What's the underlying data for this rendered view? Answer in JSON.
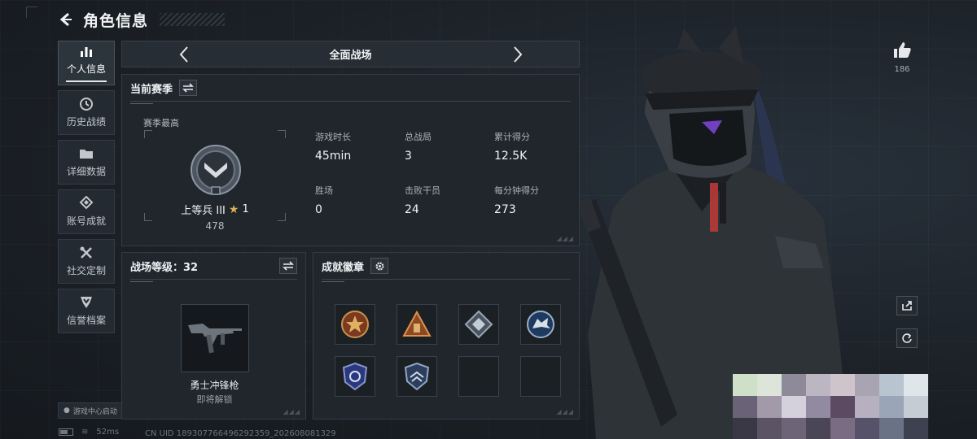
{
  "header": {
    "title": "角色信息"
  },
  "sidebar": {
    "items": [
      {
        "label": "个人信息",
        "icon": "bar-chart-icon",
        "active": true
      },
      {
        "label": "历史战绩",
        "icon": "clock-icon",
        "active": false
      },
      {
        "label": "详细数据",
        "icon": "folder-icon",
        "active": false
      },
      {
        "label": "账号成就",
        "icon": "achievement-icon",
        "active": false
      },
      {
        "label": "社交定制",
        "icon": "tools-icon",
        "active": false
      },
      {
        "label": "信誉档案",
        "icon": "shield-icon",
        "active": false
      }
    ],
    "launch_badge": "游戏中心启动"
  },
  "mode": {
    "label": "全面战场"
  },
  "season": {
    "title": "当前赛季",
    "best_label": "赛季最高",
    "rank_name": "上等兵 III",
    "rank_stars": "1",
    "rank_score": "478",
    "stats": [
      {
        "label": "游戏时长",
        "value": "45min"
      },
      {
        "label": "总战局",
        "value": "3"
      },
      {
        "label": "累计得分",
        "value": "12.5K"
      },
      {
        "label": "胜场",
        "value": "0"
      },
      {
        "label": "击败干员",
        "value": "24"
      },
      {
        "label": "每分钟得分",
        "value": "273"
      }
    ]
  },
  "level": {
    "title": "战场等级：32",
    "weapon_name": "勇士冲锋枪",
    "weapon_status": "即将解锁"
  },
  "achievements": {
    "title": "成就徽章",
    "badges": [
      {
        "icon": "star-medal-icon",
        "color": "#b5562a"
      },
      {
        "icon": "triangle-badge-icon",
        "color": "#c8743a"
      },
      {
        "icon": "diamond-badge-icon",
        "color": "#7a8796"
      },
      {
        "icon": "wolf-badge-icon",
        "color": "#3c6aa0"
      },
      {
        "icon": "police-badge-icon",
        "color": "#4a5ec0"
      },
      {
        "icon": "shield-crest-icon",
        "color": "#5c7aa8"
      },
      {
        "icon": "empty-slot",
        "color": ""
      },
      {
        "icon": "empty-slot",
        "color": ""
      }
    ]
  },
  "right": {
    "like_count": "186"
  },
  "status": {
    "ping": "52ms",
    "uid": "CN UID 18930776649629235​9_202608081329"
  }
}
